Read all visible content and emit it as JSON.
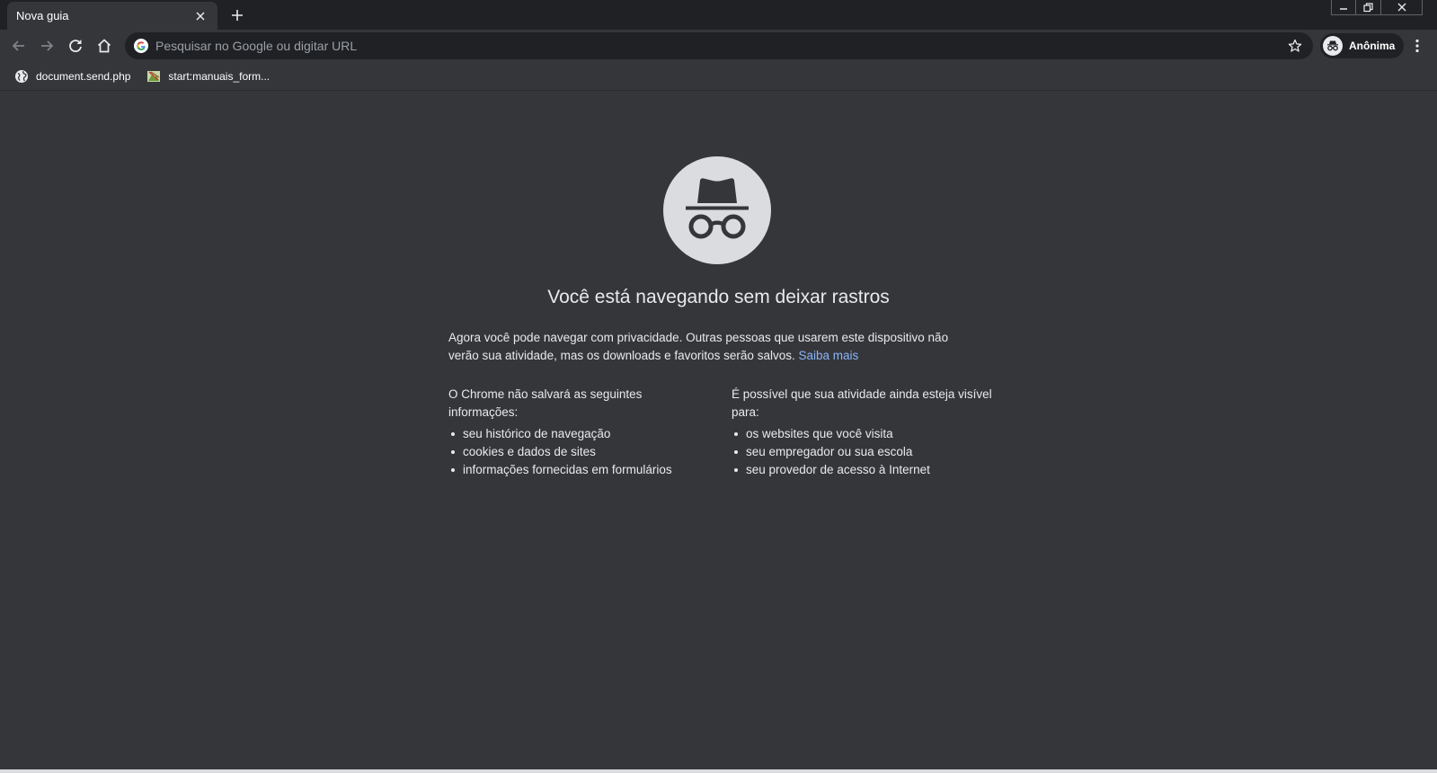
{
  "tab": {
    "title": "Nova guia"
  },
  "toolbar": {
    "omnibox_placeholder": "Pesquisar no Google ou digitar URL",
    "profile_label": "Anônima"
  },
  "bookmarks": [
    {
      "label": "document.send.php",
      "icon": "globe-icon"
    },
    {
      "label": "start:manuais_form...",
      "icon": "site-favicon"
    }
  ],
  "main": {
    "headline": "Você está navegando sem deixar rastros",
    "intro": "Agora você pode navegar com privacidade. Outras pessoas que usarem este dispositivo não verão sua atividade, mas os downloads e favoritos serão salvos.",
    "learn_more": "Saiba mais",
    "left_title": "O Chrome não salvará as seguintes informações:",
    "left_items": [
      "seu histórico de navegação",
      "cookies e dados de sites",
      "informações fornecidas em formulários"
    ],
    "right_title": "É possível que sua atividade ainda esteja visível para:",
    "right_items": [
      "os websites que você visita",
      "seu empregador ou sua escola",
      "seu provedor de acesso à Internet"
    ]
  },
  "colors": {
    "tabstrip_bg": "#202124",
    "page_bg": "#35363a",
    "text": "#e8eaed",
    "link": "#8ab4f8"
  }
}
